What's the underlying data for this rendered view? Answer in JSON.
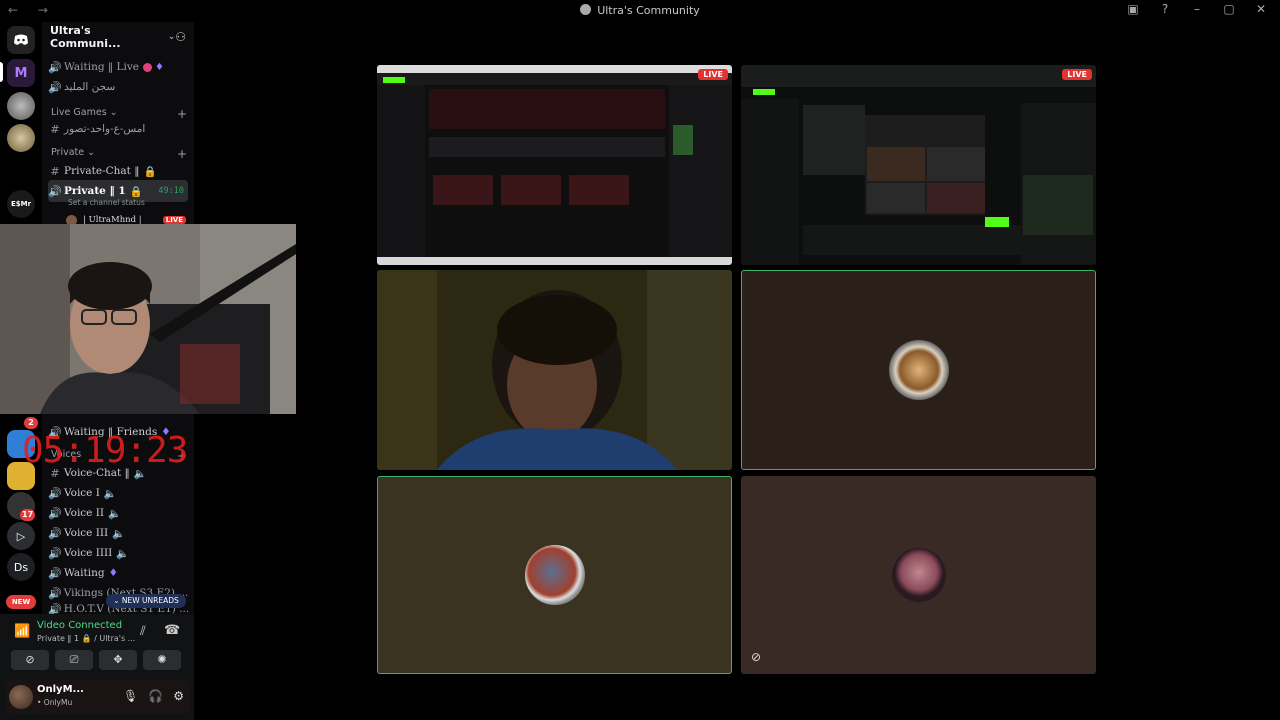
{
  "window": {
    "title": "Ultra's Community"
  },
  "server": {
    "name": "Ultra's Communi..."
  },
  "channels": {
    "top": [
      {
        "label": "Waiting ‖ Live"
      },
      {
        "label": "سجن المليد"
      }
    ],
    "live_games": {
      "label": "Live Games"
    },
    "live_games_item": "امس-ع-واحد-تصور",
    "private": {
      "label": "Private"
    },
    "private_chat": "Private-Chat ‖",
    "private_voice": "Private ‖ 1",
    "private_voice_time": "49:10",
    "set_status": "Set a channel status",
    "user_in_voice": "| UltraMhnd |",
    "user_live": "LIVE",
    "lower": [
      "Waiting ‖ Friends",
      "Voice-Chat ‖",
      "Voice I",
      "Voice II",
      "Voice III",
      "Voice IIII",
      "Waiting",
      "Vikings (Next S3 E2) ...",
      "H.O.T.V (Next S1 E1) ..."
    ],
    "voices_cat": "Voices"
  },
  "timer": "05:19:23",
  "new_unreads": "NEW UNREADS",
  "guild_labels": {
    "ds": "Ds",
    "new": "NEW",
    "emr": "E$Mr"
  },
  "guild_badges": {
    "b1": "2",
    "b2": "17"
  },
  "voice_panel": {
    "status": "Video Connected",
    "sub": "Private ‖ 1 🔒 / Ultra's ..."
  },
  "user": {
    "name": "OnlyM...",
    "status": "• OnlyMu"
  },
  "tiles": {
    "live_label": "LIVE"
  }
}
